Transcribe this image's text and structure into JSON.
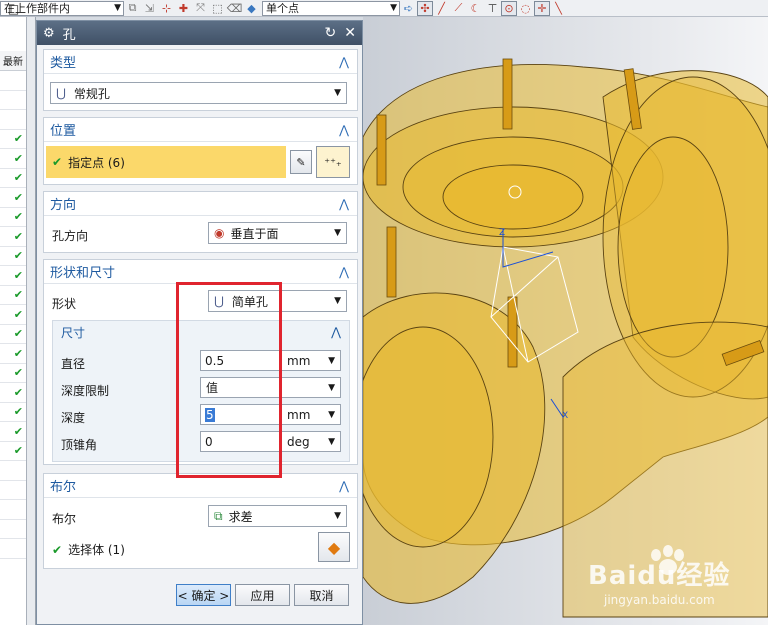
{
  "toolbar": {
    "scope_select": "在上作部件内",
    "snap_select": "单个点"
  },
  "left_panel": {
    "header": "最新",
    "top_icon": "□"
  },
  "dialog": {
    "title": "孔",
    "type": {
      "header": "类型",
      "value": "常规孔"
    },
    "position": {
      "header": "位置",
      "point_label": "指定点 (6)"
    },
    "direction": {
      "header": "方向",
      "label": "孔方向",
      "value": "垂直于面"
    },
    "shape": {
      "header": "形状和尺寸",
      "shape_label": "形状",
      "shape_value": "简单孔",
      "dims": {
        "header": "尺寸",
        "diameter_label": "直径",
        "diameter_value": "0.5",
        "diameter_unit": "mm",
        "depth_limit_label": "深度限制",
        "depth_limit_value": "值",
        "depth_label": "深度",
        "depth_value": "5",
        "depth_unit": "mm",
        "tip_label": "顶锥角",
        "tip_value": "0",
        "tip_unit": "deg"
      }
    },
    "boolean": {
      "header": "布尔",
      "label": "布尔",
      "value": "求差",
      "select_body": "选择体 (1)"
    },
    "buttons": {
      "ok": "< 确定 >",
      "apply": "应用",
      "cancel": "取消"
    }
  },
  "watermark": {
    "brand": "Baidu经验",
    "url": "jingyan.baidu.com"
  },
  "colors": {
    "accent": "#1e5aa0",
    "highlight": "#fbd86a",
    "red": "#e0242e",
    "part": "#e8b930"
  }
}
